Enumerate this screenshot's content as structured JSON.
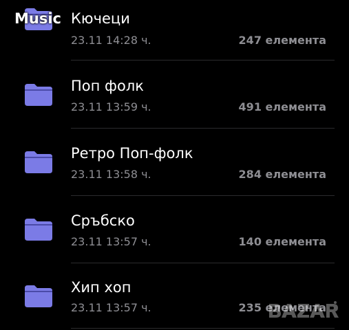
{
  "app": {
    "title": "Music"
  },
  "accent": "#7b7be6",
  "folders": [
    {
      "name": "Кючеци",
      "date": "23.11 14:28 ч.",
      "count": "247 елемента"
    },
    {
      "name": "Поп фолк",
      "date": "23.11 13:59 ч.",
      "count": "491 елемента"
    },
    {
      "name": "Ретро Поп-фолк",
      "date": "23.11 13:58 ч.",
      "count": "284 елемента"
    },
    {
      "name": "Сръбско",
      "date": "23.11 13:57 ч.",
      "count": "140 елемента"
    },
    {
      "name": "Хип хоп",
      "date": "23.11 13:57 ч.",
      "count": "235 елемента"
    }
  ],
  "watermark": {
    "text": "BAZAR"
  }
}
